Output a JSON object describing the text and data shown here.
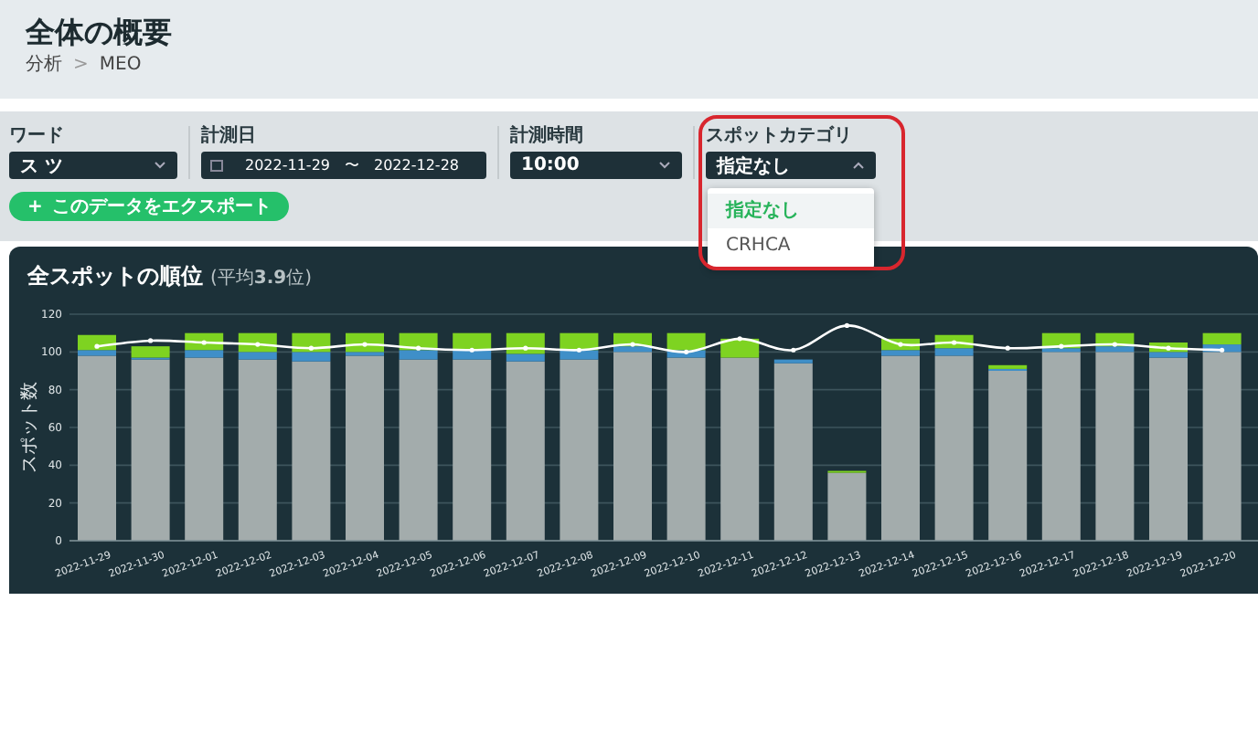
{
  "page": {
    "title": "全体の概要",
    "breadcrumb": [
      "分析",
      "MEO"
    ],
    "breadcrumb_separator": ">"
  },
  "filters": [
    {
      "kind": "select",
      "label": "ワード",
      "value": "ス ツ",
      "expanded": false,
      "highlighted": false
    },
    {
      "kind": "date_range",
      "label": "計測日",
      "start": "2022-11-29",
      "separator": "〜",
      "end": "2022-12-28",
      "highlighted": false
    },
    {
      "kind": "select",
      "label": "計測時間",
      "value": "10:00",
      "expanded": false,
      "highlighted": false
    },
    {
      "kind": "select",
      "label": "スポットカテゴリ",
      "value": "指定なし",
      "expanded": true,
      "highlighted": true,
      "options": [
        {
          "label": "指定なし",
          "selected": true
        },
        {
          "label": "CRHCA",
          "selected": false
        }
      ]
    }
  ],
  "export_button": {
    "icon": "+",
    "label": "このデータをエクスポート"
  },
  "chart_panel": {
    "title": "全スポットの順位",
    "subtitle": "(平均**3.9**位)",
    "chart_data": {
      "type": "bar",
      "stacked": true,
      "grid": true,
      "ylabel": "スポット数",
      "ylim": [
        0,
        120
      ],
      "yticks": [
        0,
        20,
        40,
        60,
        80,
        100,
        120
      ],
      "categories": [
        "2022-11-29",
        "2022-11-30",
        "2022-12-01",
        "2022-12-02",
        "2022-12-03",
        "2022-12-04",
        "2022-12-05",
        "2022-12-06",
        "2022-12-07",
        "2022-12-08",
        "2022-12-09",
        "2022-12-10",
        "2022-12-11",
        "2022-12-12",
        "2022-12-13",
        "2022-12-14",
        "2022-12-15",
        "2022-12-16",
        "2022-12-17",
        "2022-12-18",
        "2022-12-19",
        "2022-12-20"
      ],
      "series": [
        {
          "type": "bar",
          "color": "#a3acac",
          "values": [
            98,
            96,
            97,
            96,
            95,
            98,
            96,
            96,
            95,
            96,
            100,
            97,
            97,
            94,
            36,
            98,
            98,
            90,
            100,
            100,
            97,
            100
          ]
        },
        {
          "type": "bar",
          "color": "#3f8fc8",
          "values": [
            3,
            1,
            4,
            4,
            5,
            2,
            5,
            5,
            4,
            5,
            3,
            4,
            0,
            2,
            0,
            3,
            4,
            1,
            2,
            3,
            3,
            4
          ]
        },
        {
          "type": "bar",
          "color": "#7ed321",
          "values": [
            8,
            6,
            9,
            10,
            10,
            10,
            9,
            9,
            11,
            9,
            7,
            9,
            10,
            0,
            1,
            6,
            7,
            2,
            8,
            7,
            5,
            6
          ]
        },
        {
          "type": "line",
          "color": "#ffffff",
          "values": [
            103,
            106,
            105,
            104,
            102,
            104,
            102,
            101,
            102,
            101,
            104,
            100,
            107,
            101,
            114,
            104,
            105,
            102,
            103,
            104,
            102,
            101
          ]
        }
      ]
    }
  }
}
